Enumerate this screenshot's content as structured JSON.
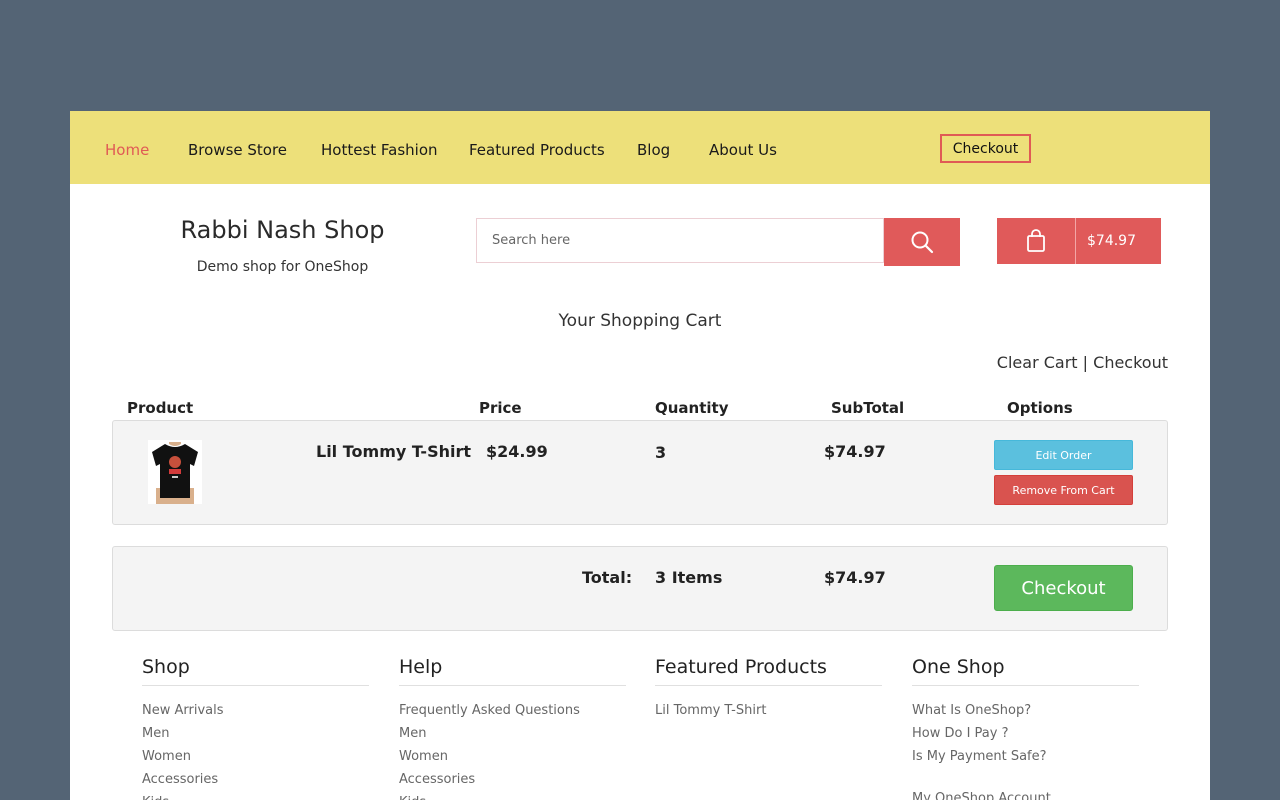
{
  "nav": {
    "items": [
      "Home",
      "Browse Store",
      "Hottest Fashion",
      "Featured Products",
      "Blog",
      "About Us"
    ],
    "checkout_label": "Checkout",
    "active_color": "#e05a55",
    "background": "#ede07a"
  },
  "header": {
    "shop_name": "Rabbi Nash Shop",
    "tagline": "Demo shop for OneShop",
    "search_placeholder": "Search here",
    "cart_total": "$74.97",
    "search_icon": "search-icon",
    "cart_icon": "shopping-bag-icon"
  },
  "cart": {
    "heading": "Your Shopping Cart",
    "clear_label": "Clear Cart",
    "separator": "|",
    "checkout_link": "Checkout",
    "columns": [
      "Product",
      "Price",
      "Quantity",
      "SubTotal",
      "Options"
    ],
    "items": [
      {
        "name": "Lil Tommy T-Shirt",
        "price": "$24.99",
        "quantity": "3",
        "subtotal": "$74.97",
        "edit_label": "Edit Order",
        "remove_label": "Remove From Cart"
      }
    ],
    "total_label": "Total:",
    "total_items": "3 Items",
    "total_amount": "$74.97",
    "checkout_button": "Checkout"
  },
  "footer": {
    "columns": [
      {
        "title": "Shop",
        "links": [
          "New Arrivals",
          "Men",
          "Women",
          "Accessories",
          "Kids"
        ]
      },
      {
        "title": "Help",
        "links": [
          "Frequently Asked Questions",
          "Men",
          "Women",
          "Accessories",
          "Kids"
        ]
      },
      {
        "title": "Featured Products",
        "links": [
          "Lil Tommy T-Shirt"
        ]
      },
      {
        "title": "One Shop",
        "links": [
          "What Is OneShop?",
          "How Do I Pay ?",
          "Is My Payment Safe?",
          "",
          "My OneShop Account"
        ]
      }
    ]
  }
}
